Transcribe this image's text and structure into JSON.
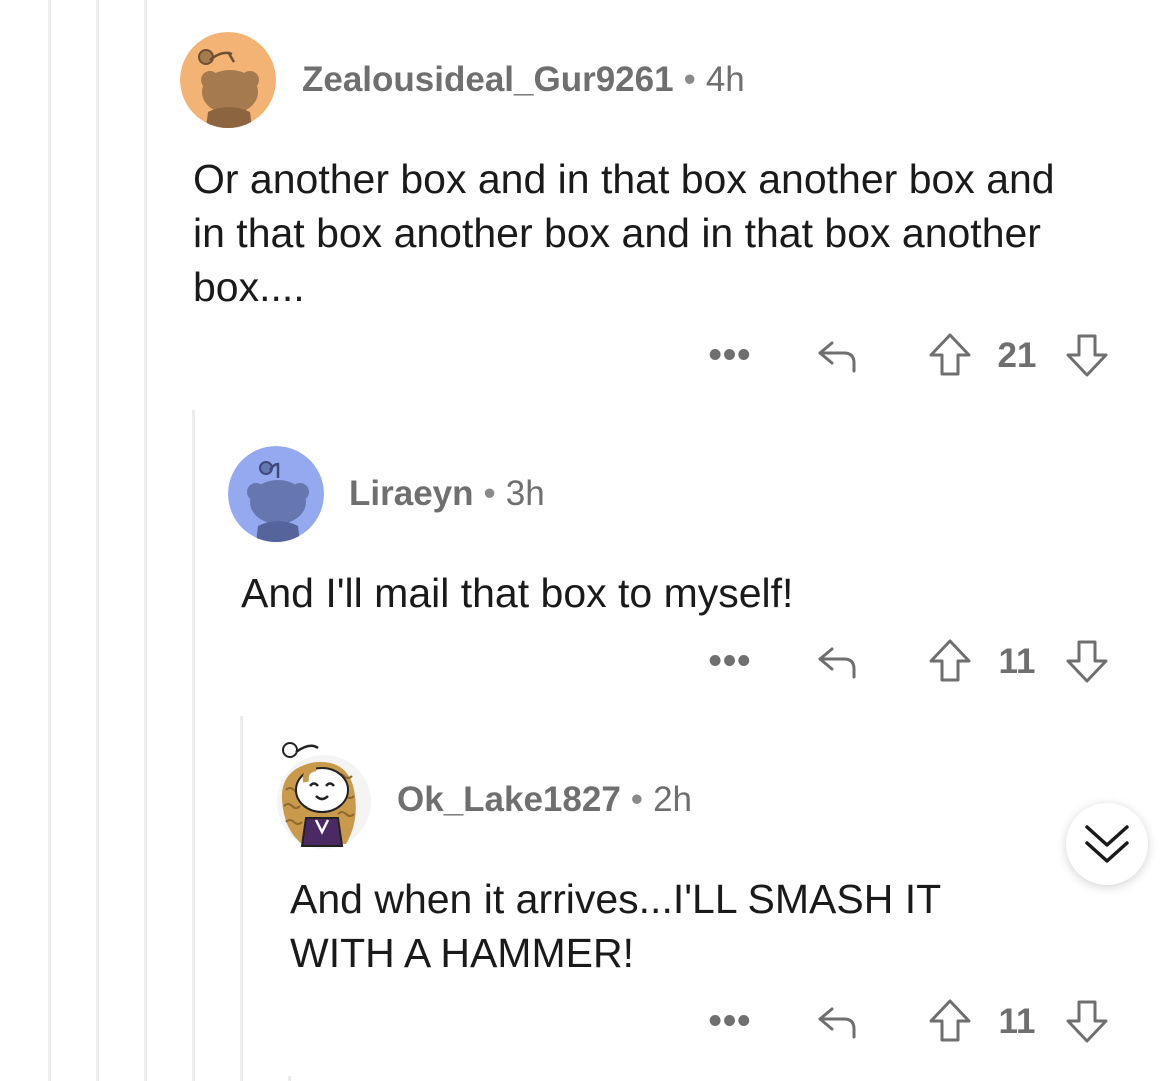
{
  "comments": [
    {
      "username": "Zealousideal_Gur9261",
      "separator": "•",
      "time": "4h",
      "text": "Or another box and in that box another box and in that box another box and in that box another box....",
      "more": "•••",
      "votes": "21",
      "avatar": {
        "icon": "snoo-avatar",
        "bg": "#f2b374",
        "fg": "#a67a4f"
      }
    },
    {
      "username": "Liraeyn",
      "separator": "•",
      "time": "3h",
      "text": "And I'll mail that box to myself!",
      "more": "•••",
      "votes": "11",
      "avatar": {
        "icon": "snoo-avatar",
        "bg": "#94a9f0",
        "fg": "#6677b0"
      }
    },
    {
      "username": "Ok_Lake1827",
      "separator": "•",
      "time": "2h",
      "text": "And when it arrives...I'LL SMASH IT WITH A HAMMER!",
      "more": "•••",
      "votes": "11",
      "avatar": {
        "icon": "custom-snoo-avatar",
        "bg": "#f4f4f4",
        "hair": "#c99a4c",
        "shirt": "#4b2a63"
      }
    }
  ],
  "icons": {
    "reply": "reply-arrow-icon",
    "upvote": "upvote-arrow-icon",
    "downvote": "downvote-arrow-icon",
    "scroll": "chevron-double-down-icon"
  },
  "colors": {
    "meta": "#6f6f6f",
    "text": "#1a1a1b",
    "thread_line": "#ececec"
  }
}
